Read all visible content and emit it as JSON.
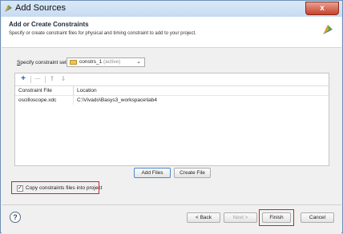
{
  "window": {
    "title": "Add Sources",
    "close_label": "x"
  },
  "header": {
    "title": "Add or Create Constraints",
    "subtitle": "Specify or create constraint files for physical and timing constraint to add to your project."
  },
  "constraint_set": {
    "label_prefix": "S",
    "label_rest": "pecify constraint set:",
    "value": "constrs_1",
    "value_suffix": "(active)"
  },
  "toolbar": {
    "add": "+",
    "remove": "—",
    "up": "⇑",
    "down": "⇓"
  },
  "table": {
    "columns": [
      "Constraint File",
      "Location"
    ],
    "rows": [
      {
        "file": "oscilloscope.xdc",
        "location": "C:\\Vivado\\Basys3_workspace\\lab4"
      }
    ]
  },
  "buttons": {
    "add_files": "Add Files",
    "create_file": "Create File",
    "back": "< Back",
    "next": "Next >",
    "finish": "Finish",
    "cancel": "Cancel"
  },
  "copy_checkbox": {
    "label": "Copy constraints files into project",
    "checked": true,
    "mark": "✓"
  },
  "help": "?"
}
